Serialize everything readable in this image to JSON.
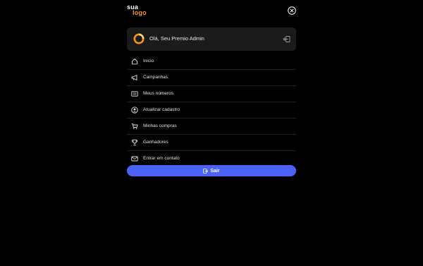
{
  "logo": {
    "line1": "sua",
    "line2": "logo"
  },
  "user": {
    "greeting": "Olá, Seu Premio Admin"
  },
  "menu": {
    "items": [
      {
        "label": "Inicio",
        "icon": "home-icon"
      },
      {
        "label": "Campanhas",
        "icon": "megaphone-icon"
      },
      {
        "label": "Meus números",
        "icon": "list-icon"
      },
      {
        "label": "Atualizar cadastro",
        "icon": "user-circle-icon"
      },
      {
        "label": "Minhas compras",
        "icon": "cart-icon"
      },
      {
        "label": "Ganhadores",
        "icon": "trophy-icon"
      },
      {
        "label": "Entrar em contato",
        "icon": "mail-icon"
      }
    ]
  },
  "logout_button": {
    "label": "Sair",
    "icon": "logout-icon"
  },
  "colors": {
    "background": "#000000",
    "accent": "#4a62f5",
    "brand": "#f7941d",
    "card": "#1b1b1b"
  }
}
